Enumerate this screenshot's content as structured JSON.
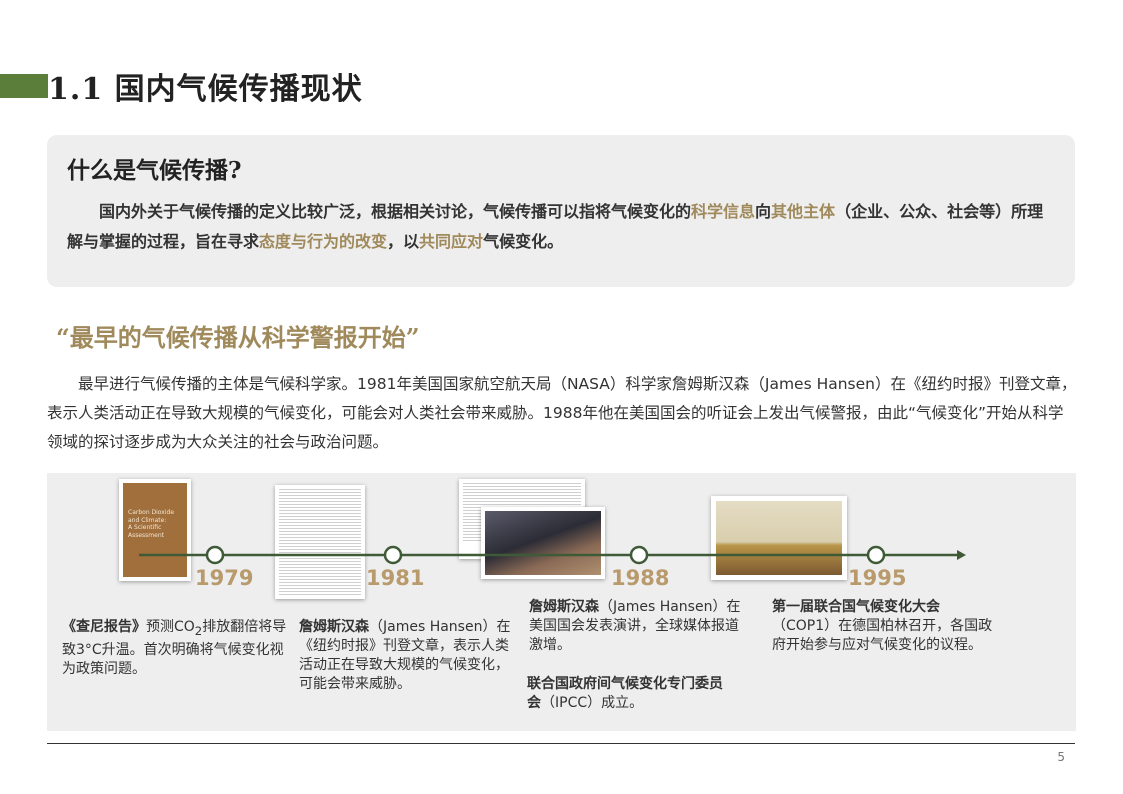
{
  "header": {
    "title": "1.1 国内气候传播现状"
  },
  "definition": {
    "heading": "什么是气候传播?",
    "body": [
      "国内外关于气候传播的定义比较广泛，根据相关讨论，气候传播可以指将气候变化的",
      "科学信息",
      "向",
      "其他主体",
      "（企业、公众、社会等）所理解与掌握的过程，旨在寻求",
      "态度与行为的改变",
      "，以",
      "共同应对",
      "气候变化。"
    ]
  },
  "section": {
    "heading": "“最早的气候传播从科学警报开始”",
    "paragraph": "最早进行气候传播的主体是气候科学家。1981年美国国家航空航天局（NASA）科学家詹姆斯汉森（James Hansen）在《纽约时报》刊登文章，表示人类活动正在导致大规模的气候变化，可能会对人类社会带来威胁。1988年他在美国国会的听证会上发出气候警报，由此“气候变化”开始从科学领域的探讨逐步成为大众关注的社会与政治问题。"
  },
  "timeline": {
    "images": {
      "report_cover_text": [
        "Carbon Dioxide",
        "and Climate:",
        "A Scientific",
        "Assessment"
      ]
    },
    "events": [
      {
        "year": "1979",
        "bold": "《查尼报告》",
        "text_before_sub": "预测CO",
        "sub": "2",
        "text_after_sub": "排放翻倍将导致3°C升温。首次明确将气候变化视为政策问题。"
      },
      {
        "year": "1981",
        "bold": "詹姆斯汉森",
        "text": "（James Hansen）在《纽约时报》刊登文章，表示人类活动正在导致大规模的气候变化，可能会带来威胁。"
      },
      {
        "year": "1988",
        "bold": "詹姆斯汉森",
        "text": "（James Hansen）在美国国会发表演讲，全球媒体报道激增。",
        "bold2": "联合国政府间气候变化专门委员会",
        "text2": "（IPCC）成立。"
      },
      {
        "year": "1995",
        "bold": "第一届联合国气候变化大会",
        "text": "（COP1）在德国柏林召开，各国政府开始参与应对气候变化的议程。"
      }
    ]
  },
  "footer": {
    "page_number": "5"
  },
  "colors": {
    "accent_green": "#5b7f3a",
    "highlight_gold": "#a08a5c",
    "timeline_line": "#3f5a36",
    "year_gold": "#b89a6c"
  }
}
